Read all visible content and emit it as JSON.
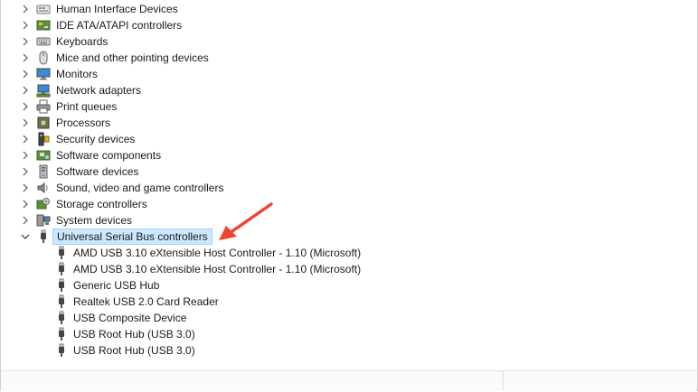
{
  "tree": {
    "categories": [
      {
        "label": "Human Interface Devices",
        "icon": "human-interface-icon",
        "expanded": false
      },
      {
        "label": "IDE ATA/ATAPI controllers",
        "icon": "ide-controller-icon",
        "expanded": false
      },
      {
        "label": "Keyboards",
        "icon": "keyboard-icon",
        "expanded": false
      },
      {
        "label": "Mice and other pointing devices",
        "icon": "mouse-icon",
        "expanded": false
      },
      {
        "label": "Monitors",
        "icon": "monitor-icon",
        "expanded": false
      },
      {
        "label": "Network adapters",
        "icon": "network-adapter-icon",
        "expanded": false
      },
      {
        "label": "Print queues",
        "icon": "printer-icon",
        "expanded": false
      },
      {
        "label": "Processors",
        "icon": "processor-icon",
        "expanded": false
      },
      {
        "label": "Security devices",
        "icon": "security-device-icon",
        "expanded": false
      },
      {
        "label": "Software components",
        "icon": "software-component-icon",
        "expanded": false
      },
      {
        "label": "Software devices",
        "icon": "software-device-icon",
        "expanded": false
      },
      {
        "label": "Sound, video and game controllers",
        "icon": "speaker-icon",
        "expanded": false
      },
      {
        "label": "Storage controllers",
        "icon": "storage-controller-icon",
        "expanded": false
      },
      {
        "label": "System devices",
        "icon": "system-device-icon",
        "expanded": false
      },
      {
        "label": "Universal Serial Bus controllers",
        "icon": "usb-icon",
        "expanded": true,
        "selected": true
      }
    ],
    "usb_children": [
      {
        "label": "AMD USB 3.10 eXtensible Host Controller - 1.10 (Microsoft)",
        "icon": "usb-icon"
      },
      {
        "label": "AMD USB 3.10 eXtensible Host Controller - 1.10 (Microsoft)",
        "icon": "usb-icon"
      },
      {
        "label": "Generic USB Hub",
        "icon": "usb-icon"
      },
      {
        "label": "Realtek USB 2.0 Card Reader",
        "icon": "usb-icon"
      },
      {
        "label": "USB Composite Device",
        "icon": "usb-icon"
      },
      {
        "label": "USB Root Hub (USB 3.0)",
        "icon": "usb-icon"
      },
      {
        "label": "USB Root Hub (USB 3.0)",
        "icon": "usb-icon"
      }
    ]
  },
  "colors": {
    "selection_bg": "#cce8ff",
    "selection_border": "#99d1ff",
    "annotation_arrow": "#ee4433"
  }
}
